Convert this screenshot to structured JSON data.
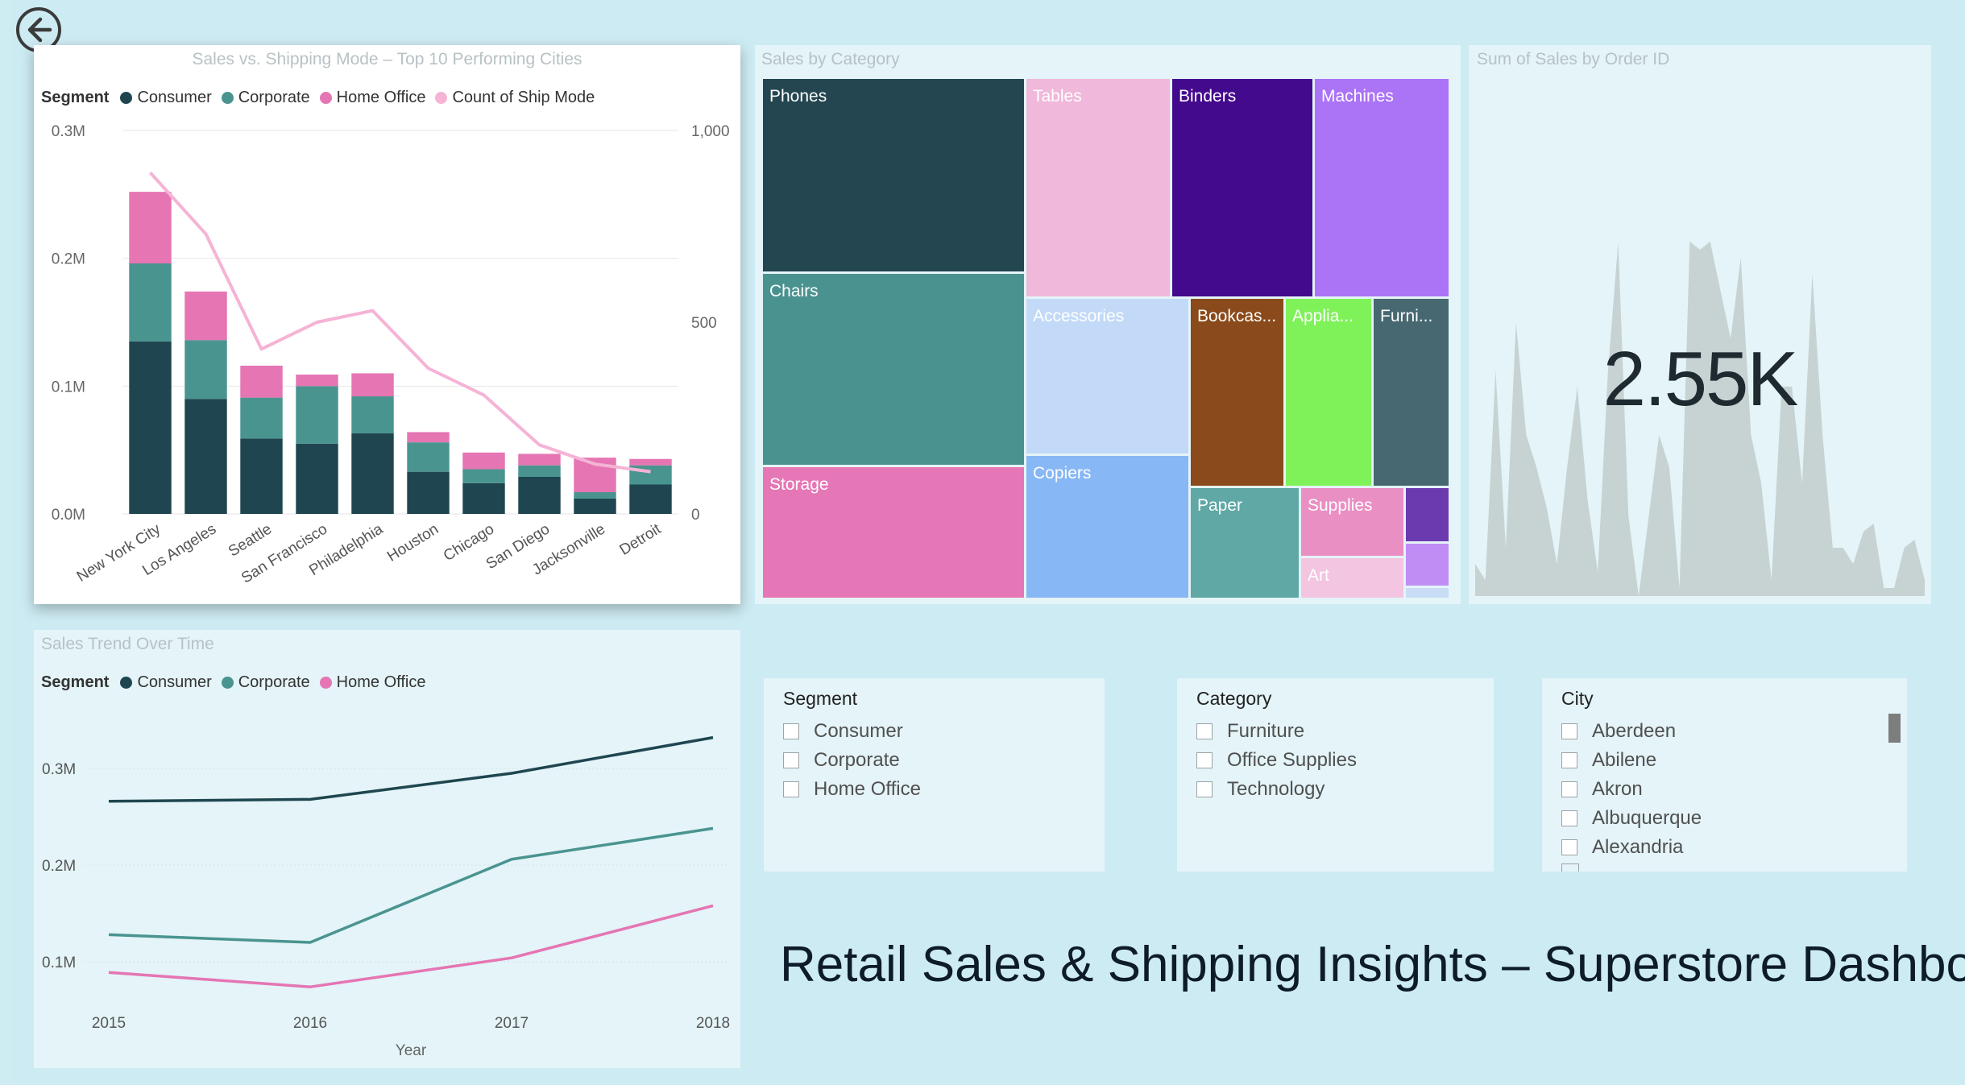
{
  "title": "Retail Sales & Shipping Insights – Superstore Dashboard",
  "back_icon": "back-arrow-icon",
  "colors": {
    "consumer": "#1f4650",
    "corporate": "#4a9490",
    "home_office": "#e575b3",
    "ship_mode_line": "#f5b3d5"
  },
  "bar_chart": {
    "title": "Sales vs. Shipping Mode – Top 10 Performing Cities",
    "legend_label": "Segment",
    "legend": [
      "Consumer",
      "Corporate",
      "Home Office",
      "Count of Ship Mode"
    ],
    "y_ticks": [
      "0.0M",
      "0.1M",
      "0.2M",
      "0.3M"
    ],
    "y2_ticks": [
      "0",
      "500",
      "1,000"
    ]
  },
  "treemap": {
    "title": "Sales by Category",
    "labels": {
      "phones": "Phones",
      "chairs": "Chairs",
      "storage": "Storage",
      "tables": "Tables",
      "binders": "Binders",
      "machines": "Machines",
      "accessories": "Accessories",
      "copiers": "Copiers",
      "bookcases": "Bookcas...",
      "appliances": "Applia...",
      "furnishings": "Furni...",
      "paper": "Paper",
      "supplies": "Supplies",
      "art": "Art"
    }
  },
  "kpi": {
    "title": "Sum of Sales by Order ID",
    "value": "2.55K"
  },
  "line_chart": {
    "title": "Sales Trend Over Time",
    "legend_label": "Segment",
    "legend": [
      "Consumer",
      "Corporate",
      "Home Office"
    ],
    "y_ticks": [
      "0.1M",
      "0.2M",
      "0.3M"
    ]
  },
  "slicers": {
    "segment": {
      "title": "Segment",
      "items": [
        "Consumer",
        "Corporate",
        "Home Office"
      ]
    },
    "category": {
      "title": "Category",
      "items": [
        "Furniture",
        "Office Supplies",
        "Technology"
      ]
    },
    "city": {
      "title": "City",
      "items": [
        "Aberdeen",
        "Abilene",
        "Akron",
        "Albuquerque",
        "Alexandria"
      ]
    }
  },
  "chart_data": [
    {
      "type": "bar",
      "title": "Sales vs. Shipping Mode – Top 10 Performing Cities",
      "categories": [
        "New York City",
        "Los Angeles",
        "Seattle",
        "San Francisco",
        "Philadelphia",
        "Houston",
        "Chicago",
        "San Diego",
        "Jacksonville",
        "Detroit"
      ],
      "series": [
        {
          "name": "Consumer",
          "values": [
            0.135,
            0.09,
            0.059,
            0.055,
            0.063,
            0.033,
            0.024,
            0.029,
            0.012,
            0.023
          ]
        },
        {
          "name": "Corporate",
          "values": [
            0.061,
            0.046,
            0.032,
            0.045,
            0.029,
            0.023,
            0.011,
            0.009,
            0.005,
            0.015
          ]
        },
        {
          "name": "Home Office",
          "values": [
            0.056,
            0.038,
            0.025,
            0.009,
            0.018,
            0.008,
            0.013,
            0.009,
            0.027,
            0.005
          ]
        }
      ],
      "line_series": {
        "name": "Count of Ship Mode",
        "values": [
          890,
          730,
          430,
          500,
          530,
          380,
          310,
          180,
          130,
          110
        ]
      },
      "legend_title": "Segment",
      "ylim": [
        0,
        0.3
      ],
      "y2lim": [
        0,
        1000
      ],
      "stacked": true
    },
    {
      "type": "line",
      "title": "Sales Trend Over Time",
      "xlabel": "Year",
      "x": [
        2015,
        2016,
        2017,
        2018
      ],
      "series": [
        {
          "name": "Consumer",
          "values": [
            0.266,
            0.268,
            0.295,
            0.332
          ]
        },
        {
          "name": "Corporate",
          "values": [
            0.128,
            0.12,
            0.206,
            0.238
          ]
        },
        {
          "name": "Home Office",
          "values": [
            0.089,
            0.074,
            0.104,
            0.158
          ]
        }
      ],
      "legend_title": "Segment"
    },
    {
      "type": "area",
      "title": "Sum of Sales by Order ID",
      "values": [
        40,
        20,
        280,
        60,
        340,
        200,
        160,
        110,
        40,
        160,
        260,
        120,
        30,
        280,
        440,
        100,
        0,
        100,
        200,
        160,
        10,
        440,
        430,
        440,
        380,
        320,
        420,
        200,
        140,
        20,
        260,
        260,
        140,
        400,
        200,
        60,
        60,
        40,
        80,
        90,
        10,
        10,
        60,
        70,
        20
      ],
      "kpi_value": "2.55K"
    },
    {
      "type": "treemap",
      "title": "Sales by Category",
      "categories": [
        "Phones",
        "Chairs",
        "Storage",
        "Tables",
        "Binders",
        "Machines",
        "Accessories",
        "Copiers",
        "Bookcases",
        "Appliances",
        "Furnishings",
        "Paper",
        "Supplies",
        "Art"
      ]
    }
  ]
}
